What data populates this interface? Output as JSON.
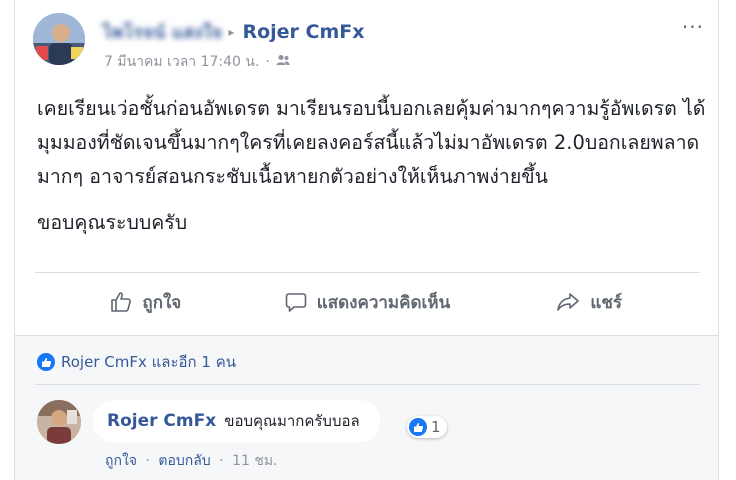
{
  "post": {
    "author": "ไพโรจน์ แสงใจ",
    "arrow": "▸",
    "target": "Rojer CmFx",
    "date": "7 มีนาคม เวลา 17:40 น.",
    "dot": "·",
    "audience_icon": "friends-icon",
    "more": "···",
    "paragraphs": [
      "เคยเรียนเว่อชั้นก่อนอัพเดรต มาเรียนรอบนี้บอกเลยคุ้มค่ามากๆความรู้อัพเดรต ได้มุมมองที่ชัดเจนขึ้นมากๆใครที่เคยลงคอร์สนี้แล้วไม่มาอัพเดรต 2.0บอกเลยพลาดมากๆ อาจารย์สอนกระชับเนื้อหายกตัวอย่างให้เห็นภาพง่ายขึ้น",
      "ขอบคุณระบบครับ"
    ]
  },
  "actions": {
    "like": "ถูกใจ",
    "comment": "แสดงความคิดเห็น",
    "share": "แชร์"
  },
  "reactions": {
    "summary": "Rojer CmFx และอีก 1 คน"
  },
  "comment": {
    "author": "Rojer CmFx",
    "text": "ขอบคุณมากครับบอล",
    "like_count": "1",
    "like_action": "ถูกใจ",
    "reply_action": "ตอบกลับ",
    "sep": "·",
    "time": "11 ชม."
  },
  "colors": {
    "link": "#365899",
    "meta": "#90949c",
    "like_blue": "#1877f2",
    "feedback_bg": "#f6f7f9"
  }
}
